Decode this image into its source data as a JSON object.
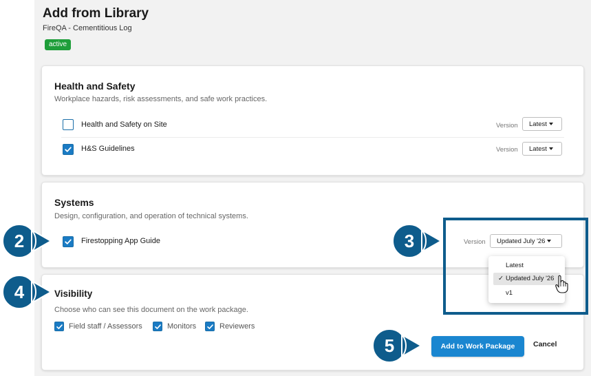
{
  "header": {
    "title": "Add from Library",
    "subtitle": "FireQA - Cementitious Log",
    "status_badge": "active"
  },
  "sections": [
    {
      "title": "Health and Safety",
      "description": "Workplace hazards, risk assessments, and safe work practices.",
      "items": [
        {
          "label": "Health and Safety on Site",
          "checked": false,
          "version_label": "Version",
          "version": "Latest"
        },
        {
          "label": "H&S Guidelines",
          "checked": true,
          "version_label": "Version",
          "version": "Latest"
        }
      ]
    },
    {
      "title": "Systems",
      "description": "Design, configuration, and operation of technical systems.",
      "items": [
        {
          "label": "Firestopping App Guide",
          "checked": true,
          "version_label": "Version",
          "version": "Updated July '26"
        }
      ]
    }
  ],
  "version_menu": {
    "options": [
      "Latest",
      "Updated July '26",
      "v1"
    ],
    "selected": "Updated July '26",
    "check_glyph": "✓"
  },
  "visibility": {
    "title": "Visibility",
    "description": "Choose who can see this document on the work package.",
    "options": [
      {
        "label": "Field staff / Assessors",
        "checked": true
      },
      {
        "label": "Monitors",
        "checked": true
      },
      {
        "label": "Reviewers",
        "checked": true
      }
    ]
  },
  "actions": {
    "primary": "Add to Work Package",
    "cancel": "Cancel"
  },
  "callouts": [
    "2",
    "3",
    "4",
    "5"
  ],
  "colors": {
    "accent": "#1a86d0",
    "callout": "#0e5c8c",
    "badge": "#1e9e3a"
  }
}
